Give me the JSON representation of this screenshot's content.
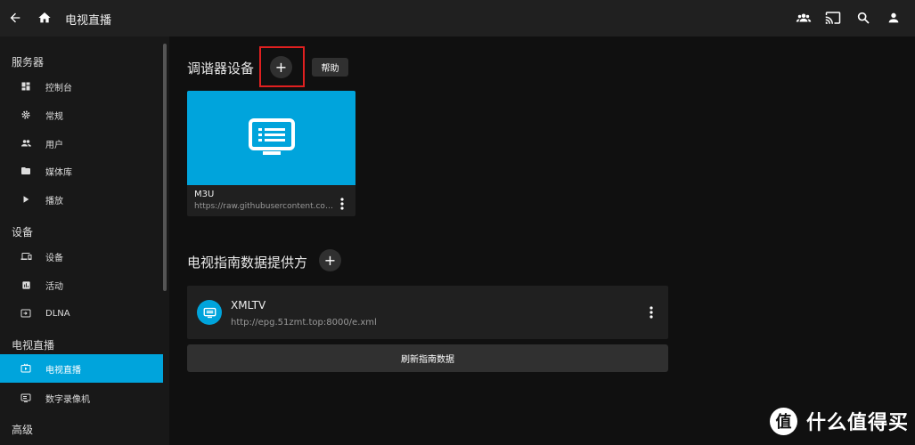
{
  "header": {
    "title": "电视直播",
    "icons": [
      "back-arrow-icon",
      "home-icon",
      "users-icon",
      "cast-icon",
      "search-icon",
      "user-icon"
    ]
  },
  "sidebar": {
    "sections": [
      {
        "title": "服务器",
        "items": [
          {
            "label": "控制台",
            "icon": "dashboard-icon"
          },
          {
            "label": "常规",
            "icon": "gear-icon"
          },
          {
            "label": "用户",
            "icon": "people-icon"
          },
          {
            "label": "媒体库",
            "icon": "folder-icon"
          },
          {
            "label": "播放",
            "icon": "play-icon"
          }
        ]
      },
      {
        "title": "设备",
        "items": [
          {
            "label": "设备",
            "icon": "devices-icon"
          },
          {
            "label": "活动",
            "icon": "chart-icon"
          },
          {
            "label": "DLNA",
            "icon": "dlna-icon"
          }
        ]
      },
      {
        "title": "电视直播",
        "items": [
          {
            "label": "电视直播",
            "icon": "live-tv-icon",
            "active": true
          },
          {
            "label": "数字录像机",
            "icon": "dvr-icon"
          }
        ]
      },
      {
        "title": "高级",
        "items": []
      }
    ]
  },
  "tuners": {
    "heading": "调谐器设备",
    "add_label": "+",
    "help_label": "帮助",
    "card": {
      "title": "M3U",
      "subtitle": "https://raw.githubusercontent.com/Yue..."
    }
  },
  "guide": {
    "heading": "电视指南数据提供方",
    "add_label": "+",
    "provider": {
      "name": "XMLTV",
      "url": "http://epg.51zmt.top:8000/e.xml"
    },
    "refresh_label": "刷新指南数据"
  },
  "watermark": {
    "logo": "值",
    "text": "什么值得买"
  },
  "colors": {
    "accent": "#00a4dc",
    "highlight_box": "#e02020",
    "background": "#101010",
    "panel": "#202020"
  }
}
